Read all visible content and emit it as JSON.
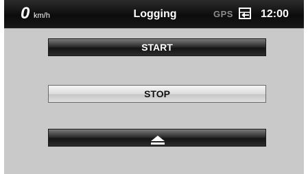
{
  "status_bar": {
    "speed_value": "0",
    "speed_unit": "km/h",
    "title": "Logging",
    "gps_label": "GPS",
    "card_icon": "memory-card-icon",
    "time": "12:00"
  },
  "buttons": {
    "start_label": "START",
    "stop_label": "STOP",
    "eject_icon": "eject-icon"
  },
  "colors": {
    "background": "#c9c9c9",
    "status_bar": "#111111",
    "gps_inactive": "#8c8c8c"
  }
}
